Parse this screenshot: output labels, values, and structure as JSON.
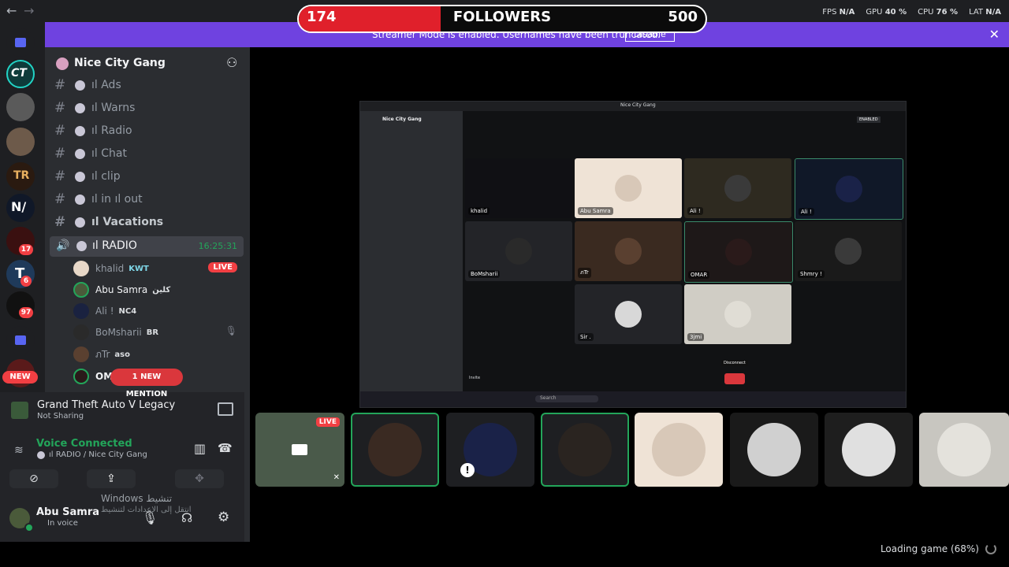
{
  "titlebar": {
    "title": "Nice City Gang",
    "back": "←",
    "forward": "→"
  },
  "stats": [
    {
      "label": "FPS",
      "value": "N/A"
    },
    {
      "label": "GPU",
      "value": "40 %"
    },
    {
      "label": "CPU",
      "value": "76 %"
    },
    {
      "label": "LAT",
      "value": "N/A"
    }
  ],
  "followers": {
    "current": "174",
    "label": "FOLLOWERS",
    "goal": "500",
    "progress_fraction": 0.348,
    "fill_color": "#e0202b"
  },
  "banner": {
    "text": "Streamer Mode is enabled. Usernames have been truncated.",
    "button": "Disable",
    "close": "✕",
    "color": "#6f42e0"
  },
  "rail": {
    "new_label": "NEW",
    "servers": [
      {
        "name": "folder",
        "badge": ""
      },
      {
        "name": "CT",
        "badge": ""
      },
      {
        "name": "server-3",
        "badge": ""
      },
      {
        "name": "server-4",
        "badge": ""
      },
      {
        "name": "TR",
        "badge": ""
      },
      {
        "name": "NV",
        "badge": ""
      },
      {
        "name": "server-7",
        "badge": "17"
      },
      {
        "name": "T",
        "badge": "6"
      },
      {
        "name": "server-9",
        "badge": "97"
      }
    ]
  },
  "channels": {
    "server_name": "Nice City Gang",
    "items": [
      {
        "label": "ıl Ads",
        "bold": false
      },
      {
        "label": "ıl Warns",
        "bold": false
      },
      {
        "label": "ıl Radio",
        "bold": false
      },
      {
        "label": "ıl Chat",
        "bold": false
      },
      {
        "label": "ıl clip",
        "bold": false
      },
      {
        "label": "ıl in ıl out",
        "bold": false
      },
      {
        "label": "ıl Vacations",
        "bold": true
      }
    ],
    "voice_channel": {
      "label": "ıl RADIO",
      "time": "16:25:31"
    },
    "voice_users": [
      {
        "name": "khalid",
        "tag": "KWT",
        "live": "LIVE"
      },
      {
        "name": "Abu Samra",
        "tag": "كلين"
      },
      {
        "name": "Ali !",
        "tag": "NC4"
      },
      {
        "name": "BoMsharii",
        "tag": "BR"
      },
      {
        "name": "ภTr",
        "tag": "aso"
      },
      {
        "name": "OMAR",
        "tag": ""
      }
    ],
    "mention": "1 NEW MENTION"
  },
  "activity": {
    "game": "Grand Theft Auto V Legacy",
    "status": "Not Sharing"
  },
  "voice_panel": {
    "title": "Voice Connected",
    "subtitle": "ıl RADIO / Nice City Gang"
  },
  "user_panel": {
    "name": "Abu Samra",
    "status": "In voice"
  },
  "watermark": {
    "line1": "Windows تنشيط",
    "line2": "انتقل إلى الإعدادات لتنشيط"
  },
  "inner": {
    "tiles": [
      {
        "name": "khalid"
      },
      {
        "name": "Abu Samra"
      },
      {
        "name": "Ali !"
      },
      {
        "name": "BoMsharii"
      },
      {
        "name": "ภTr"
      },
      {
        "name": "OMAR"
      },
      {
        "name": "Shmry !"
      },
      {
        "name": "Sir ."
      },
      {
        "name": "3jmi"
      }
    ],
    "disconnect": "Disconnect",
    "invite": "Invite",
    "search": "Search",
    "enabled": "ENABLED"
  },
  "strip": {
    "live": "LIVE"
  },
  "loading": "Loading game (68%)"
}
